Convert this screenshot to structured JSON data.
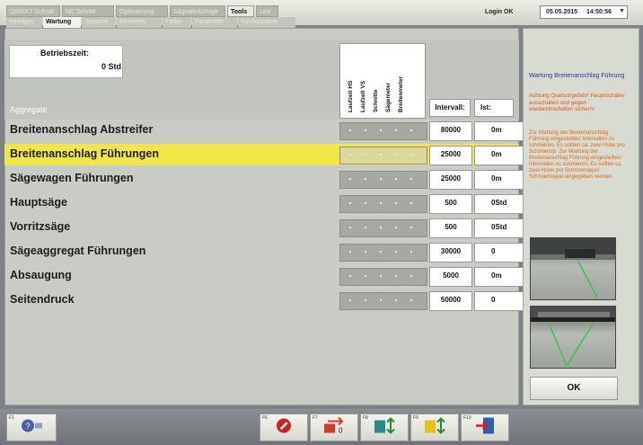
{
  "header": {
    "tabs_row1": [
      "DIREKT Schnitt",
      "NC Schnitt",
      "Optimierung",
      "Sägewerkzeuge",
      "Tools",
      "Lexi"
    ],
    "tabs_row1_active": 4,
    "tabs_row2": [
      "Reinigen",
      "Wartung",
      "Sprache",
      "Einheiten",
      "Farbe",
      "Parameter",
      "Konfiguration"
    ],
    "tabs_row2_active": 1,
    "login": "Login OK",
    "date": "05.05.2015",
    "time": "14:50:56"
  },
  "betrieb": {
    "label": "Betriebszeit:",
    "value": "0 Std"
  },
  "table": {
    "aggregate_label": "Aggregate",
    "vertical_headers": [
      "Laufzeit HS",
      "Laufzeit VS",
      "Schnitte",
      "Sägemeter",
      "Breitenmeter"
    ],
    "intervall_label": "Intervall:",
    "ist_label": "Ist:",
    "rows": [
      {
        "name": "Breitenanschlag Abstreifer",
        "interval": "80000",
        "ist": "0m",
        "selected": false
      },
      {
        "name": "Breitenanschlag Führungen",
        "interval": "25000",
        "ist": "0m",
        "selected": true
      },
      {
        "name": "Sägewagen Führungen",
        "interval": "25000",
        "ist": "0m",
        "selected": false
      },
      {
        "name": "Hauptsäge",
        "interval": "500",
        "ist": "0Std",
        "selected": false
      },
      {
        "name": "Vorritzsäge",
        "interval": "500",
        "ist": "0Std",
        "selected": false
      },
      {
        "name": "Sägeaggregat Führungen",
        "interval": "30000",
        "ist": "0",
        "selected": false
      },
      {
        "name": "Absaugung",
        "interval": "5000",
        "ist": "0m",
        "selected": false
      },
      {
        "name": "Seitendruck",
        "interval": "50000",
        "ist": "0",
        "selected": false
      }
    ]
  },
  "right_panel": {
    "title": "Wartung Breitenanschlag Führung",
    "warning": "Achtung Quetschgefahr! Hauptschalter ausschalten und gegen wiedereinschalten sichern!",
    "description": "Zur Wartung der Breitenanschlag Führung eingestellten Intervallen zu schmieren. Es sollten ca. zwei Hübe pro Schmiernip. Zur Wartung der Breitenanschlag Führung eingestellten Intervallen zu schmieren. Es sollten ca. zwei Hübe pro Schmiernippel Schmiernippel eingegeben werden.",
    "ok_label": "OK"
  },
  "footer": {
    "keys": [
      "F1",
      "F6",
      "F7",
      "F8",
      "F9",
      "F10"
    ]
  },
  "colors": {
    "selected_row": "#f0e64a",
    "accent_orange": "#e05a10",
    "title_blue": "#1c3e94"
  }
}
